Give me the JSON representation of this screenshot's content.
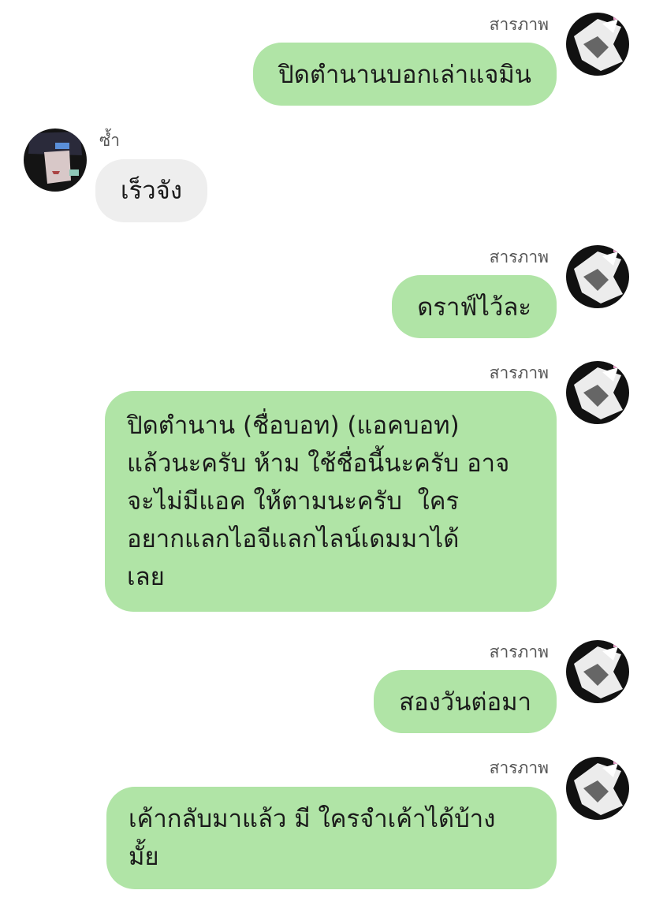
{
  "messages": [
    {
      "sender": "สารภาพ",
      "text": "ปิดตำนานบอกเล่าแจมิน"
    },
    {
      "sender": "ซ้ำ",
      "text": "เร็วจัง"
    },
    {
      "sender": "สารภาพ",
      "text": "ดราฟ์ไว้ละ"
    },
    {
      "sender": "สารภาพ",
      "text": "ปิดตำนาน (ชื่อบอท) (แอคบอท)\nแล้วนะครับ ห้าม ใช้ชื่อนี้นะครับ อาจ\nจะไม่มีแอค ให้ตามนะครับ  ใคร\nอยากแลกไอจีแลกไลน์เดมมาได้\nเลย"
    },
    {
      "sender": "สารภาพ",
      "text": "สองวันต่อมา"
    },
    {
      "sender": "สารภาพ",
      "text": "เค้ากลับมาแล้ว มี ใครจำเค้าได้บ้าง\nมั้ย"
    }
  ],
  "colors": {
    "outgoing_bubble": "#b0e4a6",
    "incoming_bubble": "#eeeeee",
    "sender_name": "#555555",
    "text": "#1a1a1a"
  },
  "avatars": {
    "outgoing": "avatar-bw-icon",
    "incoming": "avatar-dark-icon"
  }
}
